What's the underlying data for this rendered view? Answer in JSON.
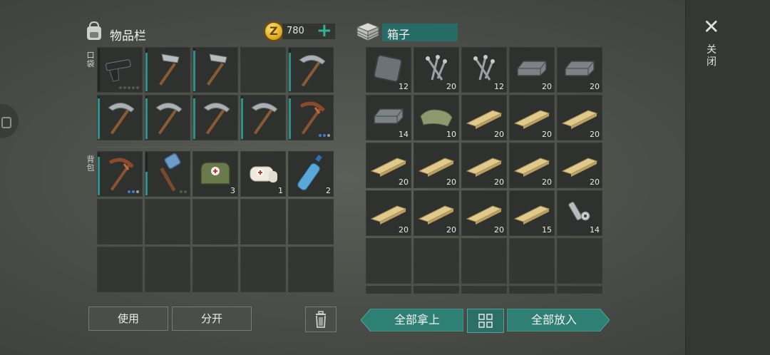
{
  "inventory": {
    "title": "物品栏",
    "coins": "780",
    "pockets_label": "口袋",
    "backpack_label": "背包",
    "pockets": [
      {
        "icon": "pistol",
        "count": "",
        "dur": 0.0,
        "dots": [
          "#555",
          "#555",
          "#555",
          "#555",
          "#555"
        ]
      },
      {
        "icon": "hammer",
        "count": "",
        "dur": 0.9
      },
      {
        "icon": "hammer",
        "count": "",
        "dur": 0.95
      },
      {
        "icon": "",
        "empty": true
      },
      {
        "icon": "pickaxe",
        "count": "",
        "dur": 0.9
      },
      {
        "icon": "pickaxe",
        "count": "",
        "dur": 0.95
      },
      {
        "icon": "pickaxe",
        "count": "",
        "dur": 0.95
      },
      {
        "icon": "pickaxe",
        "count": "",
        "dur": 0.95
      },
      {
        "icon": "pickaxe",
        "count": "",
        "dur": 0.95
      },
      {
        "icon": "crude-pickaxe",
        "count": "",
        "dur": 0.95,
        "dots": [
          "#3f7fc1",
          "#3f7fc1",
          "#9aa0a0"
        ]
      }
    ],
    "backpack": [
      {
        "icon": "crude-pickaxe",
        "count": "",
        "dur": 0.9,
        "dots": [
          "#3f7fc1",
          "#3f7fc1",
          "#9aa0a0"
        ]
      },
      {
        "icon": "sledgehammer",
        "count": "",
        "dur": 0.55,
        "dots": [
          "#555",
          "#555"
        ]
      },
      {
        "icon": "medkit-bag",
        "count": "3"
      },
      {
        "icon": "bandage",
        "count": "1"
      },
      {
        "icon": "water-bottle",
        "count": "2"
      },
      {
        "empty": true
      },
      {
        "empty": true
      },
      {
        "empty": true
      },
      {
        "empty": true
      },
      {
        "empty": true
      },
      {
        "empty": true
      },
      {
        "empty": true
      },
      {
        "empty": true
      },
      {
        "empty": true
      },
      {
        "empty": true
      }
    ],
    "use_label": "使用",
    "split_label": "分开"
  },
  "box": {
    "title": "箱子",
    "items": [
      {
        "icon": "iron-plate",
        "count": "12"
      },
      {
        "icon": "nails",
        "count": "20"
      },
      {
        "icon": "nails",
        "count": "12"
      },
      {
        "icon": "iron-bar",
        "count": "20"
      },
      {
        "icon": "iron-bar",
        "count": "20"
      },
      {
        "icon": "iron-bar",
        "count": "14"
      },
      {
        "icon": "cloth",
        "count": "10"
      },
      {
        "icon": "plank",
        "count": "20"
      },
      {
        "icon": "plank",
        "count": "20"
      },
      {
        "icon": "plank",
        "count": "20"
      },
      {
        "icon": "plank",
        "count": "20"
      },
      {
        "icon": "plank",
        "count": "20"
      },
      {
        "icon": "plank",
        "count": "20"
      },
      {
        "icon": "plank",
        "count": "20"
      },
      {
        "icon": "plank",
        "count": "20"
      },
      {
        "icon": "plank",
        "count": "20"
      },
      {
        "icon": "plank",
        "count": "20"
      },
      {
        "icon": "plank",
        "count": "20"
      },
      {
        "icon": "plank",
        "count": "15"
      },
      {
        "icon": "bolts",
        "count": "14"
      },
      {
        "empty": true
      },
      {
        "empty": true
      },
      {
        "empty": true
      },
      {
        "empty": true
      },
      {
        "empty": true
      }
    ],
    "take_all_label": "全部拿上",
    "put_all_label": "全部放入"
  },
  "close_label": "关闭",
  "colors": {
    "accent": "#2f8074",
    "durability": "#2e8f8b",
    "coin": "#d8a31b"
  }
}
